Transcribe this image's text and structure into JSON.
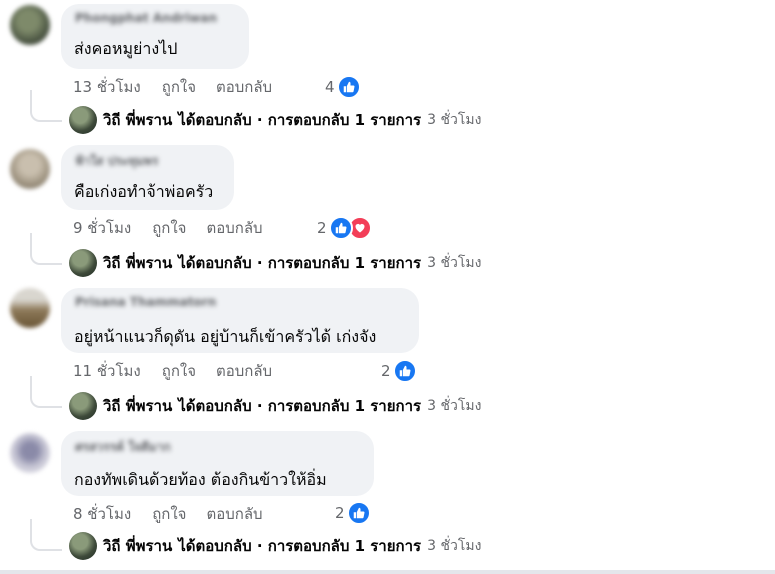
{
  "comments": [
    {
      "author": "Phongphat Andriwan",
      "text": "ส่งคอหมูย่างไป",
      "time": "13 ชั่วโมง",
      "like_label": "ถูกใจ",
      "reply_label": "ตอบกลับ",
      "reaction_count": "4",
      "reactions": [
        "like"
      ],
      "reply": {
        "name": "วิถี พี่พราน",
        "action": "ได้ตอบกลับ · การตอบกลับ 1 รายการ",
        "time": "3 ชั่วโมง"
      }
    },
    {
      "author": "ฟ้าใส ประทุมพร",
      "text": "คือเก่งอทำจ้าพ่อครัว",
      "time": "9 ชั่วโมง",
      "like_label": "ถูกใจ",
      "reply_label": "ตอบกลับ",
      "reaction_count": "2",
      "reactions": [
        "like",
        "love"
      ],
      "reply": {
        "name": "วิถี พี่พราน",
        "action": "ได้ตอบกลับ · การตอบกลับ 1 รายการ",
        "time": "3 ชั่วโมง"
      }
    },
    {
      "author": "Prisana Thammatorn",
      "text": "อยู่หน้าแนวก็ดุดัน อยู่บ้านก็เข้าครัวได้ เก่งจัง",
      "time": "11 ชั่วโมง",
      "like_label": "ถูกใจ",
      "reply_label": "ตอบกลับ",
      "reaction_count": "2",
      "reactions": [
        "like"
      ],
      "reply": {
        "name": "วิถี พี่พราน",
        "action": "ได้ตอบกลับ · การตอบกลับ 1 รายการ",
        "time": "3 ชั่วโมง"
      }
    },
    {
      "author": "ศรสวรรค์ ใจดีมาก",
      "text": "กองทัพเดินด้วยท้อง ต้องกินข้าวให้อิ่ม",
      "time": "8 ชั่วโมง",
      "like_label": "ถูกใจ",
      "reply_label": "ตอบกลับ",
      "reaction_count": "2",
      "reactions": [
        "like"
      ],
      "reply": {
        "name": "วิถี พี่พราน",
        "action": "ได้ตอบกลับ · การตอบกลับ 1 รายการ",
        "time": "3 ชั่วโมง"
      }
    }
  ],
  "colors": {
    "bubble": "#f0f2f5",
    "meta": "#65676b",
    "like": "#1877f2",
    "love": "#f33e58"
  }
}
